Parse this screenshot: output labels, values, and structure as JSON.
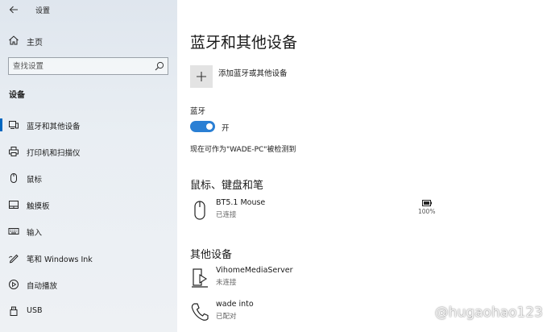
{
  "window": {
    "title": "设置",
    "back_icon": "back-arrow-icon"
  },
  "sidebar": {
    "home_label": "主页",
    "search_placeholder": "查找设置",
    "section_title": "设备",
    "items": [
      {
        "label": "蓝牙和其他设备",
        "icon": "bluetooth-devices-icon",
        "active": true
      },
      {
        "label": "打印机和扫描仪",
        "icon": "printer-icon",
        "active": false
      },
      {
        "label": "鼠标",
        "icon": "mouse-icon",
        "active": false
      },
      {
        "label": "触摸板",
        "icon": "touchpad-icon",
        "active": false
      },
      {
        "label": "输入",
        "icon": "keyboard-icon",
        "active": false
      },
      {
        "label": "笔和 Windows Ink",
        "icon": "pen-icon",
        "active": false
      },
      {
        "label": "自动播放",
        "icon": "autoplay-icon",
        "active": false
      },
      {
        "label": "USB",
        "icon": "usb-icon",
        "active": false
      }
    ]
  },
  "main": {
    "title": "蓝牙和其他设备",
    "add_device_label": "添加蓝牙或其他设备",
    "bluetooth_label": "蓝牙",
    "bluetooth_state": "开",
    "discoverable_text": "现在可作为\"WADE-PC\"被检测到",
    "mouse_section": {
      "title": "鼠标、键盘和笔",
      "devices": [
        {
          "name": "BT5.1 Mouse",
          "status": "已连接",
          "battery": "100%"
        }
      ]
    },
    "other_section": {
      "title": "其他设备",
      "devices": [
        {
          "name": "VihomeMediaServer",
          "status": "未连接"
        },
        {
          "name": "wade into",
          "status": "已配对"
        }
      ]
    }
  },
  "watermark": "@hugaohao123",
  "colors": {
    "accent": "#0067c0",
    "toggle_on": "#2a7fd4"
  }
}
